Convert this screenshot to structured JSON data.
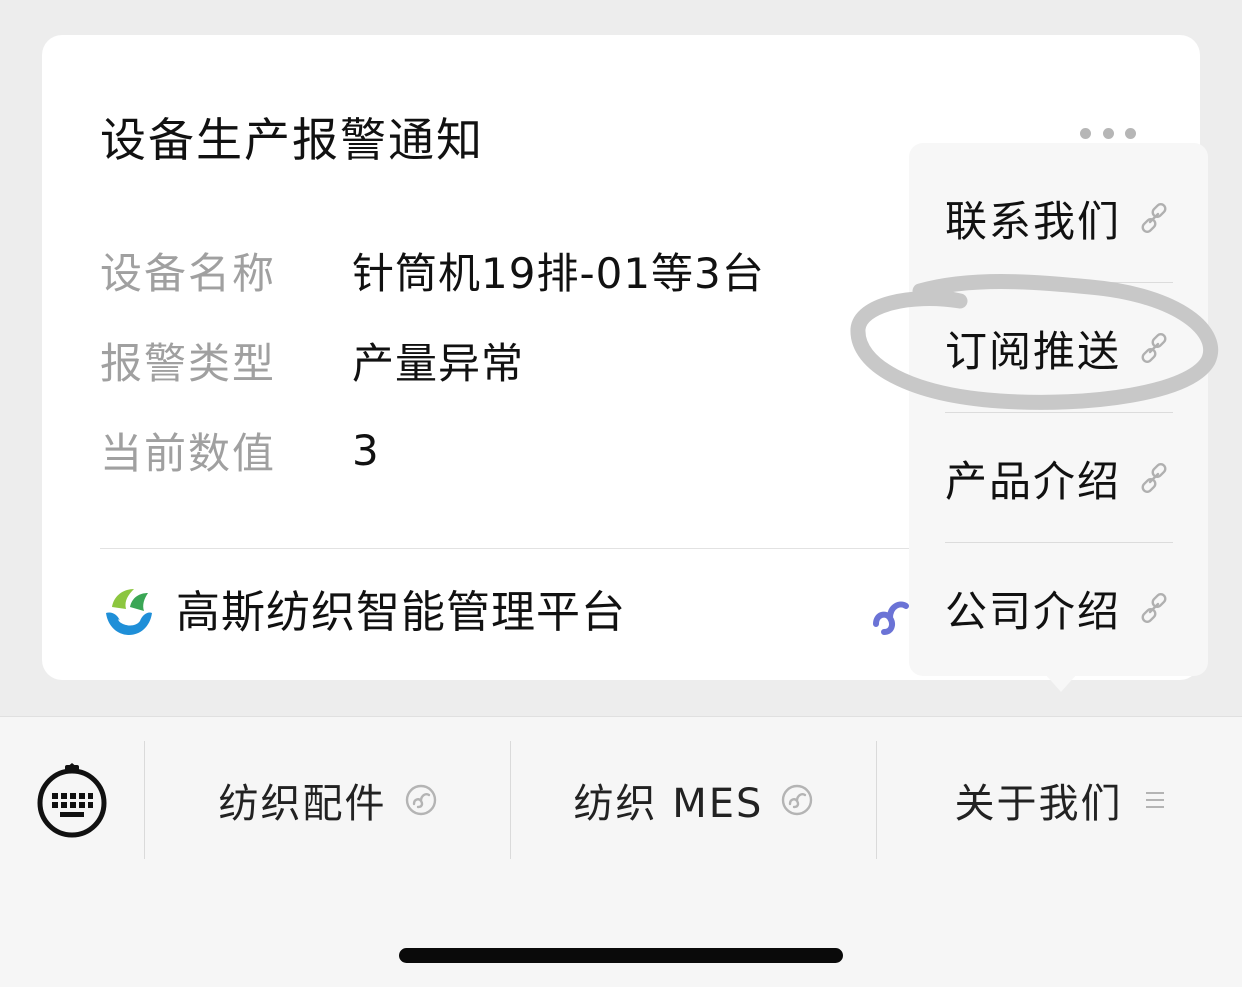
{
  "card": {
    "title": "设备生产报警通知",
    "fields": [
      {
        "label": "设备名称",
        "value": "针筒机19排-01等3台"
      },
      {
        "label": "报警类型",
        "value": "产量异常"
      },
      {
        "label": "当前数值",
        "value": "3"
      }
    ],
    "brand_name": "高斯纺织智能管理平台",
    "brand_logo_icon": "brand-logo-icon",
    "mini_program_icon": "mini-program-icon"
  },
  "popup_menu": {
    "items": [
      {
        "label": "联系我们",
        "icon": "link-icon"
      },
      {
        "label": "订阅推送",
        "icon": "link-icon",
        "highlighted": true
      },
      {
        "label": "产品介绍",
        "icon": "link-icon"
      },
      {
        "label": "公司介绍",
        "icon": "link-icon"
      }
    ],
    "highlight_color": "#c8c8c8"
  },
  "menu_bar": {
    "keyboard_icon": "keyboard-icon",
    "items": [
      {
        "label": "纺织配件",
        "icon": "mini-program-icon"
      },
      {
        "label": "纺织 MES",
        "icon": "mini-program-icon"
      },
      {
        "label": "关于我们",
        "icon": "list-icon"
      }
    ]
  },
  "colors": {
    "background": "#ededed",
    "card": "#ffffff",
    "label_gray": "#a0a0a0",
    "mini_program_blue": "#6b73d6"
  }
}
